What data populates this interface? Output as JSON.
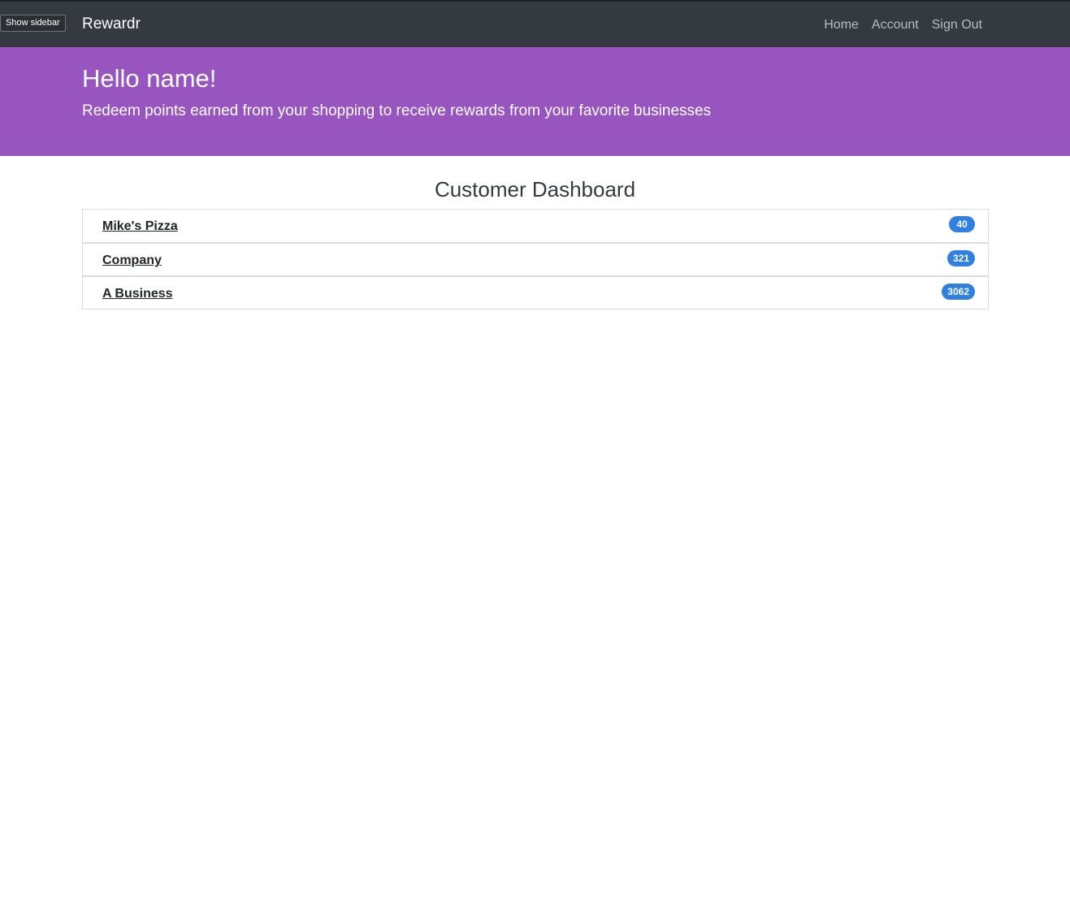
{
  "navbar": {
    "sidebar_toggle_label": "Show sidebar",
    "brand": "Rewardr",
    "links": [
      {
        "label": "Home"
      },
      {
        "label": "Account"
      },
      {
        "label": "Sign Out"
      }
    ]
  },
  "hero": {
    "title": "Hello name!",
    "subtitle": "Redeem points earned from your shopping to receive rewards from your favorite businesses"
  },
  "dashboard": {
    "title": "Customer Dashboard",
    "businesses": [
      {
        "name": "Mike's Pizza",
        "points": "40"
      },
      {
        "name": "Company",
        "points": "321"
      },
      {
        "name": "A Business",
        "points": "3062"
      }
    ]
  },
  "colors": {
    "navbar_bg": "#343a40",
    "hero_bg": "#9855bf",
    "badge_bg": "#2f80e0"
  }
}
